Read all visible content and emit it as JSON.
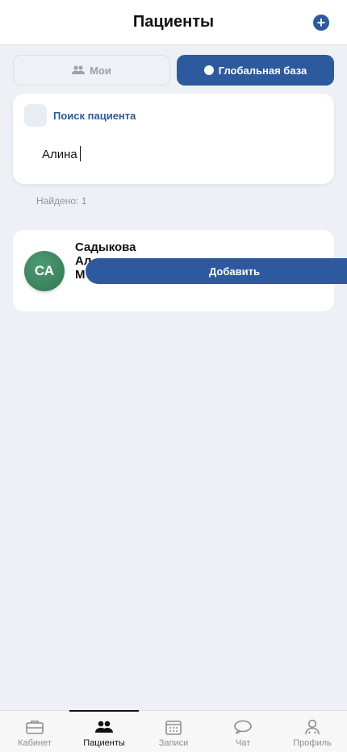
{
  "header": {
    "title": "Пациенты",
    "add_icon": "plus-circle-icon"
  },
  "segments": {
    "mine": "Мои",
    "global": "Глобальная база"
  },
  "search": {
    "label": "Поиск пациента",
    "value": "Алина",
    "placeholder": ""
  },
  "results": {
    "found_text": "Найдено: 1"
  },
  "patient": {
    "initials": "СА",
    "name": "Садыкова Ал… М…",
    "name_lines": [
      "Садыкова",
      "Ал",
      "М"
    ],
    "add_label": "Добавить"
  },
  "tabs": [
    {
      "label": "Кабинет",
      "icon": "briefcase-icon"
    },
    {
      "label": "Пациенты",
      "icon": "people-icon",
      "active": true
    },
    {
      "label": "Записи",
      "icon": "calendar-icon"
    },
    {
      "label": "Чат",
      "icon": "chat-icon"
    },
    {
      "label": "Профиль",
      "icon": "profile-icon"
    }
  ],
  "colors": {
    "accent": "#2d5a9e",
    "background": "#edf0f4",
    "avatar": "#3f8a63"
  }
}
